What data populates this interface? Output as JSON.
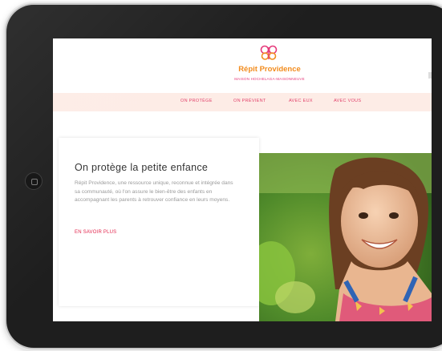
{
  "site": {
    "name": "Répit Providence",
    "subtitle": "MAISON HOCHELAGA-MAISONNEUVE"
  },
  "nav": {
    "items": [
      "ON PROTÈGE",
      "ON PRÉVIENT",
      "AVEC EUX",
      "AVEC VOUS"
    ]
  },
  "hero": {
    "title": "On protège la petite enfance",
    "body": "Répit Providence, une ressource unique, reconnue et intégrée dans sa communauté, où l'on assure le bien-être des enfants en accompagnant les parents à retrouver confiance en leurs moyens.",
    "cta": "EN SAVOIR PLUS"
  },
  "colors": {
    "brand_orange": "#f28c1e",
    "brand_pink": "#e5397a",
    "nav_bg": "#fdece6",
    "frame": "#1e1e1e"
  },
  "icons": {
    "logo": "butterfly-icon",
    "home": "home-button-icon"
  }
}
